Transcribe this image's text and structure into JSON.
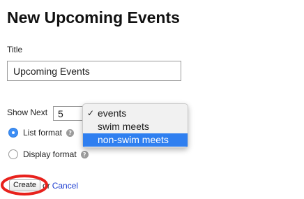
{
  "page": {
    "title": "New Upcoming Events"
  },
  "form": {
    "title_label": "Title",
    "title_value": "Upcoming Events",
    "show_next_label": "Show Next",
    "show_next_value": "5",
    "category_options": [
      "events",
      "swim meets",
      "non-swim meets"
    ],
    "category_checked": "events",
    "category_highlighted": "non-swim meets",
    "format_options": [
      {
        "label": "List format",
        "checked": true,
        "help_icon": "question-circle-icon"
      },
      {
        "label": "Display format",
        "checked": false,
        "help_icon": "question-circle-icon"
      }
    ]
  },
  "actions": {
    "create_label": "Create",
    "or_text": "or",
    "cancel_label": "Cancel"
  },
  "annotation": {
    "highlight_color": "#e8211c",
    "target": "create-button"
  },
  "colors": {
    "menu_highlight": "#2f7ff0",
    "radio_checked": "#3d8ef5",
    "link": "#1f3fd1"
  }
}
